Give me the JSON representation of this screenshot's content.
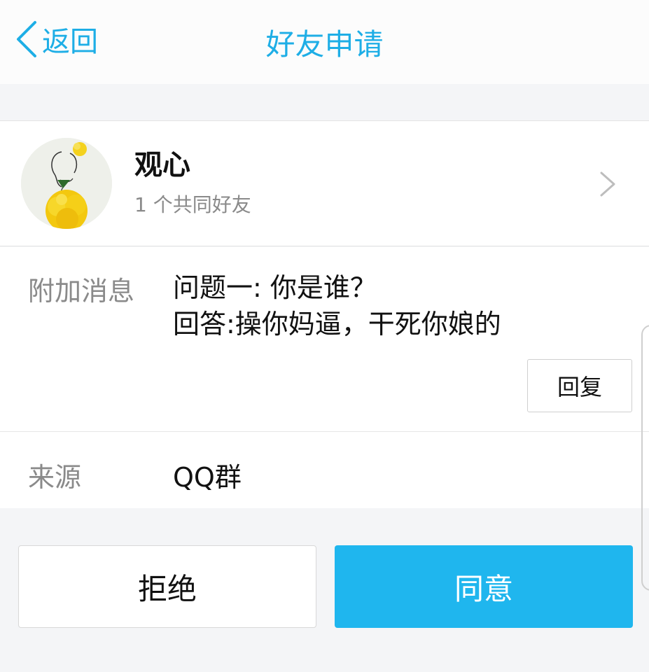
{
  "nav": {
    "back_label": "返回",
    "title": "好友申请"
  },
  "profile": {
    "nickname": "观心",
    "mutual_friends": "1 个共同好友"
  },
  "message": {
    "label": "附加消息",
    "lines": [
      "问题一: 你是谁？",
      "回答:操你妈逼，干死你娘的"
    ],
    "reply_label": "回复"
  },
  "source": {
    "label": "来源",
    "value": "QQ群"
  },
  "actions": {
    "reject_label": "拒绝",
    "accept_label": "同意"
  },
  "colors": {
    "accent": "#1eaee6",
    "accept_bg": "#1fb6ee"
  }
}
